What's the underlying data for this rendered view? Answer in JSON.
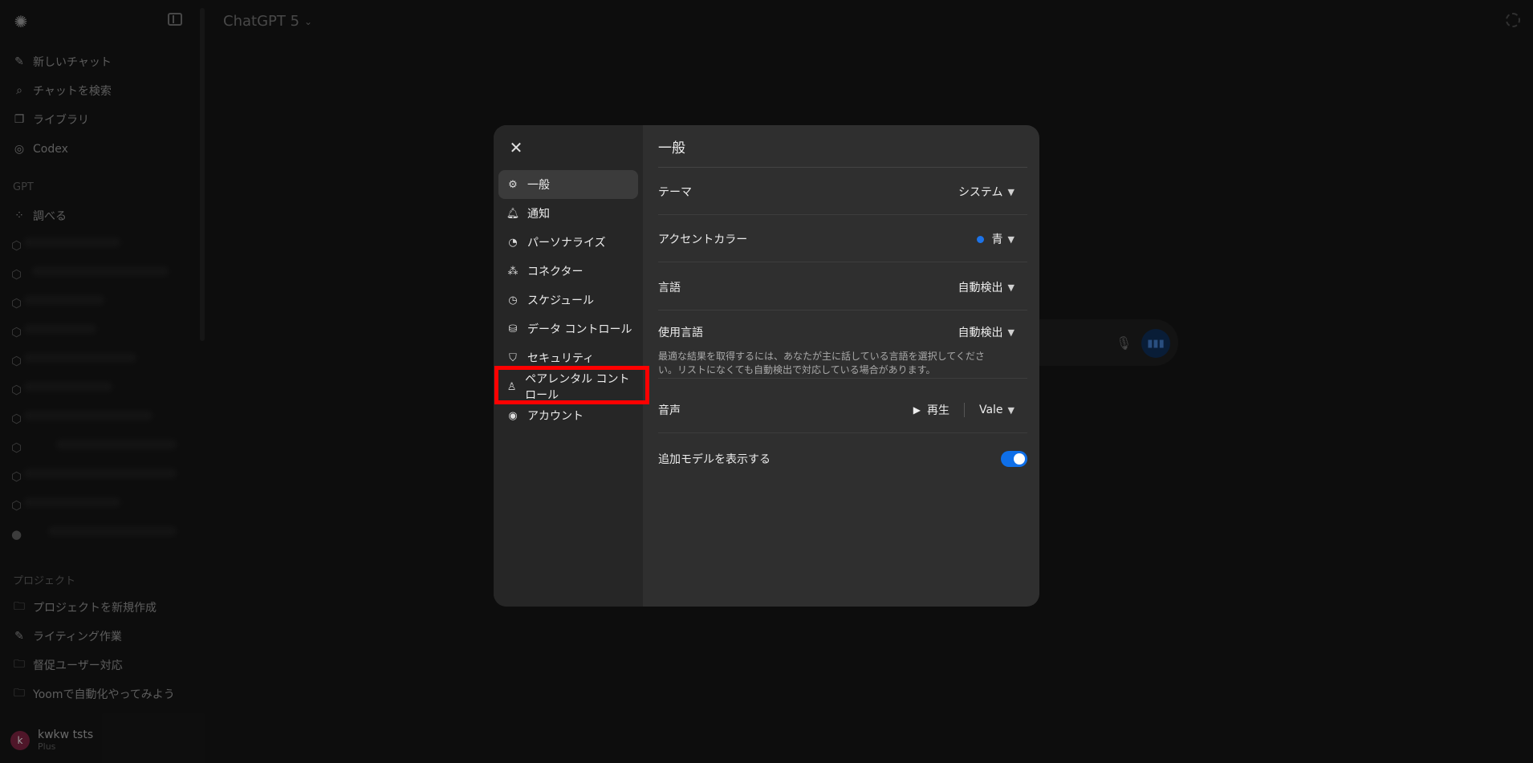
{
  "app": {
    "model_title": "ChatGPT 5"
  },
  "sidebar": {
    "new_chat": "新しいチャット",
    "search_chats": "チャットを検索",
    "library": "ライブラリ",
    "codex": "Codex",
    "gpt_section": "GPT",
    "explore": "調べる",
    "projects_section": "プロジェクト",
    "new_project": "プロジェクトを新規作成",
    "projects": [
      "ライティング作業",
      "督促ユーザー対応",
      "Yoomで自動化やってみよう"
    ]
  },
  "user": {
    "name": "kwkw tsts",
    "plan": "Plus",
    "initial": "k"
  },
  "settings": {
    "nav": [
      "一般",
      "通知",
      "パーソナライズ",
      "コネクター",
      "スケジュール",
      "データ コントロール",
      "セキュリティ",
      "ペアレンタル コントロール",
      "アカウント"
    ],
    "page_title": "一般",
    "theme": {
      "label": "テーマ",
      "value": "システム"
    },
    "accent": {
      "label": "アクセントカラー",
      "value": "青",
      "color": "#1d73e8"
    },
    "language": {
      "label": "言語",
      "value": "自動検出"
    },
    "spoken_language": {
      "label": "使用言語",
      "value": "自動検出",
      "description": "最適な結果を取得するには、あなたが主に話している言語を選択してください。リストになくても自動検出で対応している場合があります。"
    },
    "voice": {
      "label": "音声",
      "play": "再生",
      "value": "Vale"
    },
    "additional_models": {
      "label": "追加モデルを表示する",
      "enabled": true
    }
  }
}
